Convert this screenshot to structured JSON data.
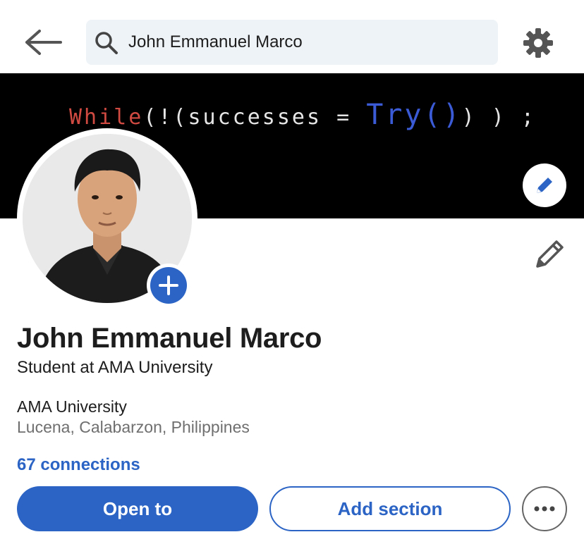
{
  "search": {
    "value": "John Emmanuel Marco"
  },
  "banner": {
    "code_keyword": "While",
    "code_part1": "(!(successes = ",
    "code_fn": "Try()",
    "code_part2": ") ) ;"
  },
  "profile": {
    "name": "John Emmanuel Marco",
    "headline": "Student at AMA University",
    "company": "AMA University",
    "location": "Lucena, Calabarzon, Philippines",
    "connections": "67 connections"
  },
  "actions": {
    "open_to": "Open to",
    "add_section": "Add section"
  },
  "icons": {
    "back": "arrow-left-icon",
    "search": "search-icon",
    "settings": "gear-icon",
    "edit_banner": "pencil-icon",
    "add_photo": "plus-icon",
    "edit_intro": "pencil-icon",
    "more": "ellipsis-icon"
  },
  "colors": {
    "accent": "#2b64c4",
    "search_bg": "#eef3f8",
    "banner_bg": "#000000",
    "keyword": "#d04a42",
    "function": "#3b5bd6"
  }
}
